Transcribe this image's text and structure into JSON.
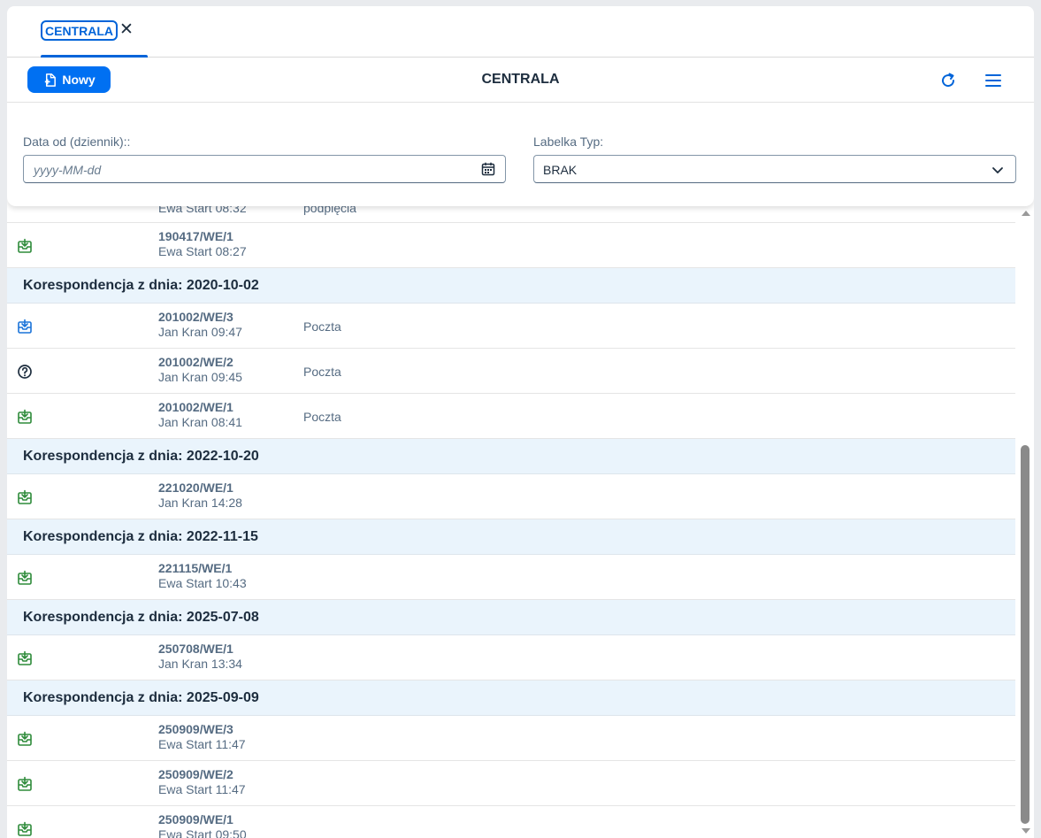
{
  "tabs": [
    {
      "label": "CENTRALA",
      "close": "✕"
    }
  ],
  "toolbar": {
    "new_label": "Nowy",
    "title": "CENTRALA",
    "refresh_icon": "refresh-icon",
    "menu_icon": "hamburger-menu-icon"
  },
  "filters": {
    "date_label": "Data od (dziennik)::",
    "date_placeholder": "yyyy-MM-dd",
    "type_label": "Labelka Typ:",
    "type_value": "BRAK"
  },
  "list": {
    "partial_row": {
      "who": "Ewa Start 08:32",
      "source": "podpięcia"
    },
    "rows_before": [
      {
        "number": "190417/WE/1",
        "who": "Ewa Start 08:27",
        "source": "",
        "icon": "green"
      }
    ],
    "groups": [
      {
        "header": "Korespondencja z dnia: 2020-10-02",
        "rows": [
          {
            "number": "201002/WE/3",
            "who": "Jan Kran 09:47",
            "source": "Poczta",
            "icon": "blue"
          },
          {
            "number": "201002/WE/2",
            "who": "Jan Kran 09:45",
            "source": "Poczta",
            "icon": "question"
          },
          {
            "number": "201002/WE/1",
            "who": "Jan Kran 08:41",
            "source": "Poczta",
            "icon": "green"
          }
        ]
      },
      {
        "header": "Korespondencja z dnia: 2022-10-20",
        "rows": [
          {
            "number": "221020/WE/1",
            "who": "Jan Kran 14:28",
            "source": "",
            "icon": "green"
          }
        ]
      },
      {
        "header": "Korespondencja z dnia: 2022-11-15",
        "rows": [
          {
            "number": "221115/WE/1",
            "who": "Ewa Start 10:43",
            "source": "",
            "icon": "green"
          }
        ]
      },
      {
        "header": "Korespondencja z dnia: 2025-07-08",
        "rows": [
          {
            "number": "250708/WE/1",
            "who": "Jan Kran 13:34",
            "source": "",
            "icon": "green"
          }
        ]
      },
      {
        "header": "Korespondencja z dnia: 2025-09-09",
        "rows": [
          {
            "number": "250909/WE/3",
            "who": "Ewa Start 11:47",
            "source": "",
            "icon": "green"
          },
          {
            "number": "250909/WE/2",
            "who": "Ewa Start 11:47",
            "source": "",
            "icon": "green"
          },
          {
            "number": "250909/WE/1",
            "who": "Ewa Start 09:50",
            "source": "",
            "icon": "green"
          }
        ]
      }
    ]
  },
  "colors": {
    "accent": "#0070f2",
    "inbox_green": "#2e8b3a",
    "inbox_blue": "#1a73d9",
    "group_bg": "#eaf4fc"
  }
}
